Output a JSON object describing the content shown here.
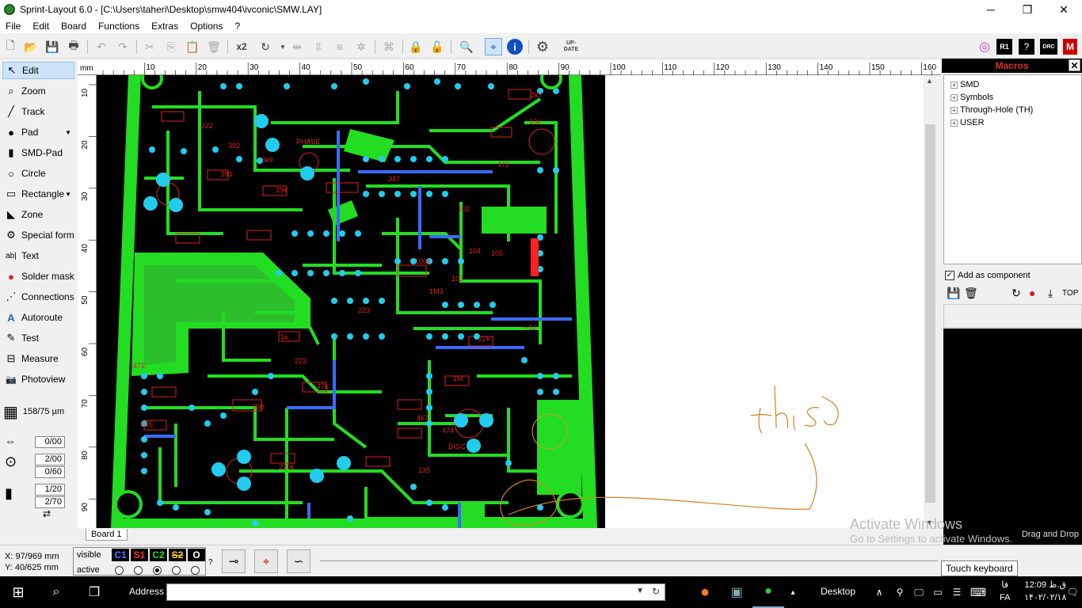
{
  "window": {
    "title": "Sprint-Layout 6.0 - [C:\\Users\\taheri\\Desktop\\smw404\\ivconic\\SMW.LAY]",
    "minimize": "─",
    "maximize": "❐",
    "close": "✕"
  },
  "menu": [
    "File",
    "Edit",
    "Board",
    "Functions",
    "Extras",
    "Options",
    "?"
  ],
  "toolbar": {
    "x2_label": "x2",
    "update_label": "UP-DATE",
    "r1_label": "R1",
    "drc_label": "DRC"
  },
  "tools": [
    {
      "label": "Edit",
      "icon": "cursor-icon",
      "glyph": "↖"
    },
    {
      "label": "Zoom",
      "icon": "magnifier-icon",
      "glyph": "⌕"
    },
    {
      "label": "Track",
      "icon": "track-icon",
      "glyph": "╱"
    },
    {
      "label": "Pad",
      "icon": "pad-icon",
      "glyph": "●"
    },
    {
      "label": "SMD-Pad",
      "icon": "smd-pad-icon",
      "glyph": "▮"
    },
    {
      "label": "Circle",
      "icon": "circle-icon",
      "glyph": "○"
    },
    {
      "label": "Rectangle",
      "icon": "rectangle-icon",
      "glyph": "▭"
    },
    {
      "label": "Zone",
      "icon": "zone-icon",
      "glyph": "◣"
    },
    {
      "label": "Special form",
      "icon": "special-form-icon",
      "glyph": "⚙"
    },
    {
      "label": "Text",
      "icon": "text-icon",
      "glyph": "ab|"
    },
    {
      "label": "Solder mask",
      "icon": "solder-mask-icon",
      "glyph": "●"
    },
    {
      "label": "Connections",
      "icon": "connections-icon",
      "glyph": "⋰"
    },
    {
      "label": "Autoroute",
      "icon": "autoroute-icon",
      "glyph": "A"
    },
    {
      "label": "Test",
      "icon": "test-icon",
      "glyph": "✎"
    },
    {
      "label": "Measure",
      "icon": "measure-icon",
      "glyph": "⊟"
    },
    {
      "label": "Photoview",
      "icon": "photoview-icon",
      "glyph": "📷"
    }
  ],
  "grid": "158/75 µm",
  "params": {
    "track_width": "0/00",
    "pad_outer": "2/00",
    "pad_inner": "0/60",
    "smd_w": "1/20",
    "smd_h": "2/70"
  },
  "ruler": {
    "unit": "mm",
    "top_ticks": [
      "10",
      "20",
      "30",
      "40",
      "50",
      "60",
      "70",
      "80",
      "90",
      "100",
      "110",
      "120",
      "130",
      "140",
      "150",
      "160"
    ],
    "left_ticks": [
      "10",
      "20",
      "30",
      "40",
      "50",
      "60",
      "70",
      "80",
      "90"
    ]
  },
  "board_text": {
    "phase": "PHASE",
    "disc": "DISC",
    "plus12": "+12",
    "r347": "347",
    "c102": "102",
    "c104": "104",
    "c105": "105",
    "c103": "103",
    "c472a": "472",
    "c472b": "472",
    "c555": "555",
    "c358": "358",
    "c223a": "223",
    "c223b": "223",
    "c393": "393",
    "c392": "392",
    "c222": "222",
    "c135": "135",
    "c474": "474",
    "r22k": "22k",
    "r10k": "10k",
    "r100k": "100k",
    "r1m": "1M",
    "r2k7": "2k7",
    "r1k": "1k",
    "r39k": "39k",
    "r4k7": "4k7",
    "r47k": "47k",
    "r220k": "220k",
    "r3k9": "3k9",
    "r1m3": "1M3"
  },
  "annotation": "this",
  "macros": {
    "title": "Macros",
    "items": [
      "SMD",
      "Symbols",
      "Through-Hole (TH)",
      "USER"
    ],
    "add_as_component": "Add as component",
    "top_label": "TOP",
    "drag_drop": "Drag and Drop"
  },
  "board_tab": "Board 1",
  "status": {
    "x": "X:   97/969 mm",
    "y": "Y:   40/625 mm",
    "visible_label": "visible",
    "active_label": "active",
    "layers": [
      "C1",
      "S1",
      "C2",
      "S2",
      "O"
    ],
    "layer_colors": [
      "#4a7bff",
      "#ff3030",
      "#22dd22",
      "#ffd700",
      "#ffffff"
    ],
    "question": "?"
  },
  "activate": {
    "line1": "Activate Windows",
    "line2": "Go to Settings to activate Windows."
  },
  "touch_keyboard": "Touch keyboard",
  "taskbar": {
    "address_label": "Address",
    "address_value": "",
    "desktop_label": "Desktop",
    "lang_top": "فا",
    "lang_bottom": "FA",
    "time": "12:09 ق.ظ",
    "date": "۱۴۰۲/۰۲/۱۸"
  }
}
